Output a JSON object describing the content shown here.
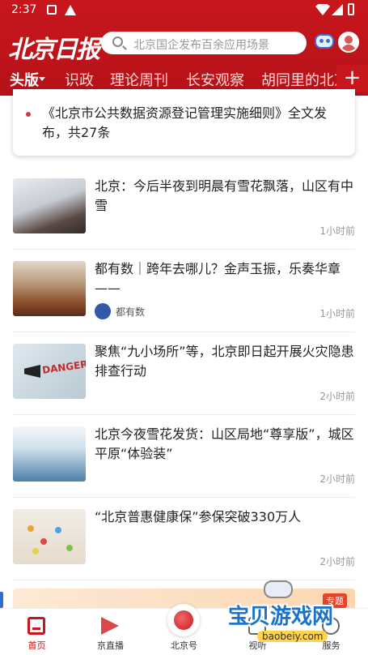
{
  "status": {
    "time": "2:37"
  },
  "header": {
    "logo": "北京日报",
    "search_placeholder": "北京国企发布百余应用场景"
  },
  "tabs": [
    {
      "label": "头版",
      "active": true
    },
    {
      "label": "识政"
    },
    {
      "label": "理论周刊"
    },
    {
      "label": "长安观察"
    },
    {
      "label": "胡同里的北京"
    }
  ],
  "plus_label": "+",
  "pinned": {
    "text": "《北京市公共数据资源登记管理实施细则》全文发布，共27条"
  },
  "news": [
    {
      "title": "北京：今后半夜到明晨有雪花飘落，山区有中雪",
      "time": "1小时前",
      "source": ""
    },
    {
      "title": "都有数｜跨年去哪儿？金声玉振，乐奏华章——",
      "time": "1小时前",
      "source": "都有数"
    },
    {
      "title": "聚焦“九小场所”等，北京即日起开展火灾隐患排查行动",
      "time": "2小时前",
      "source": "",
      "thumb_text": "DANGER"
    },
    {
      "title": "北京今夜雪花发货：山区局地“尊享版”，城区平原“体验装”",
      "time": "2小时前",
      "source": ""
    },
    {
      "title": "“北京普惠健康保”参保突破330万人",
      "time": "2小时前",
      "source": ""
    }
  ],
  "ad": {
    "tag": "专题"
  },
  "bottom_nav": [
    {
      "label": "首页",
      "active": true
    },
    {
      "label": "京直播"
    },
    {
      "label": "北京号"
    },
    {
      "label": "视听"
    },
    {
      "label": "服务"
    }
  ],
  "watermark": {
    "text": "宝贝游戏网",
    "url": "baobeiy.com"
  },
  "colors": {
    "brand_red": "#c8161d",
    "accent_blue": "#1a73c9"
  }
}
